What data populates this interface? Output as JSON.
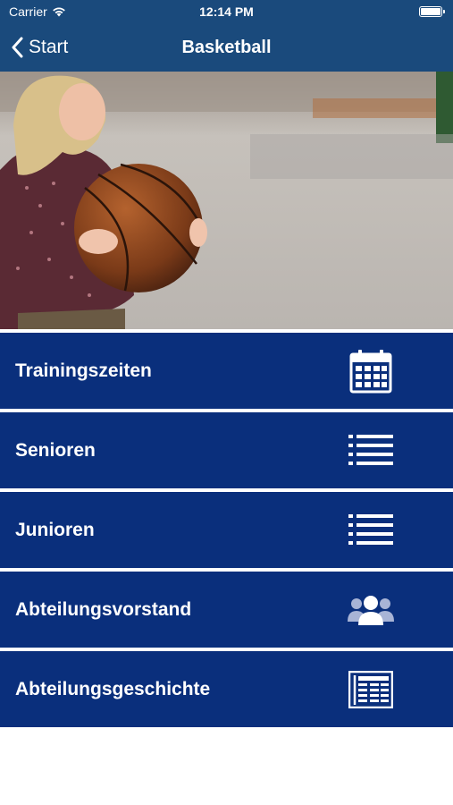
{
  "status_bar": {
    "carrier": "Carrier",
    "time": "12:14 PM"
  },
  "nav": {
    "back_label": "Start",
    "title": "Basketball",
    "background": "#1a4a7c"
  },
  "hero": {
    "description_icon": "hero-photo"
  },
  "menu": {
    "item_color": "#0a2f7c",
    "items": [
      {
        "label": "Trainingszeiten",
        "icon": "calendar-icon"
      },
      {
        "label": "Senioren",
        "icon": "list-icon"
      },
      {
        "label": "Junioren",
        "icon": "list-icon"
      },
      {
        "label": "Abteilungsvorstand",
        "icon": "people-icon"
      },
      {
        "label": "Abteilungsgeschichte",
        "icon": "newspaper-icon"
      }
    ]
  }
}
